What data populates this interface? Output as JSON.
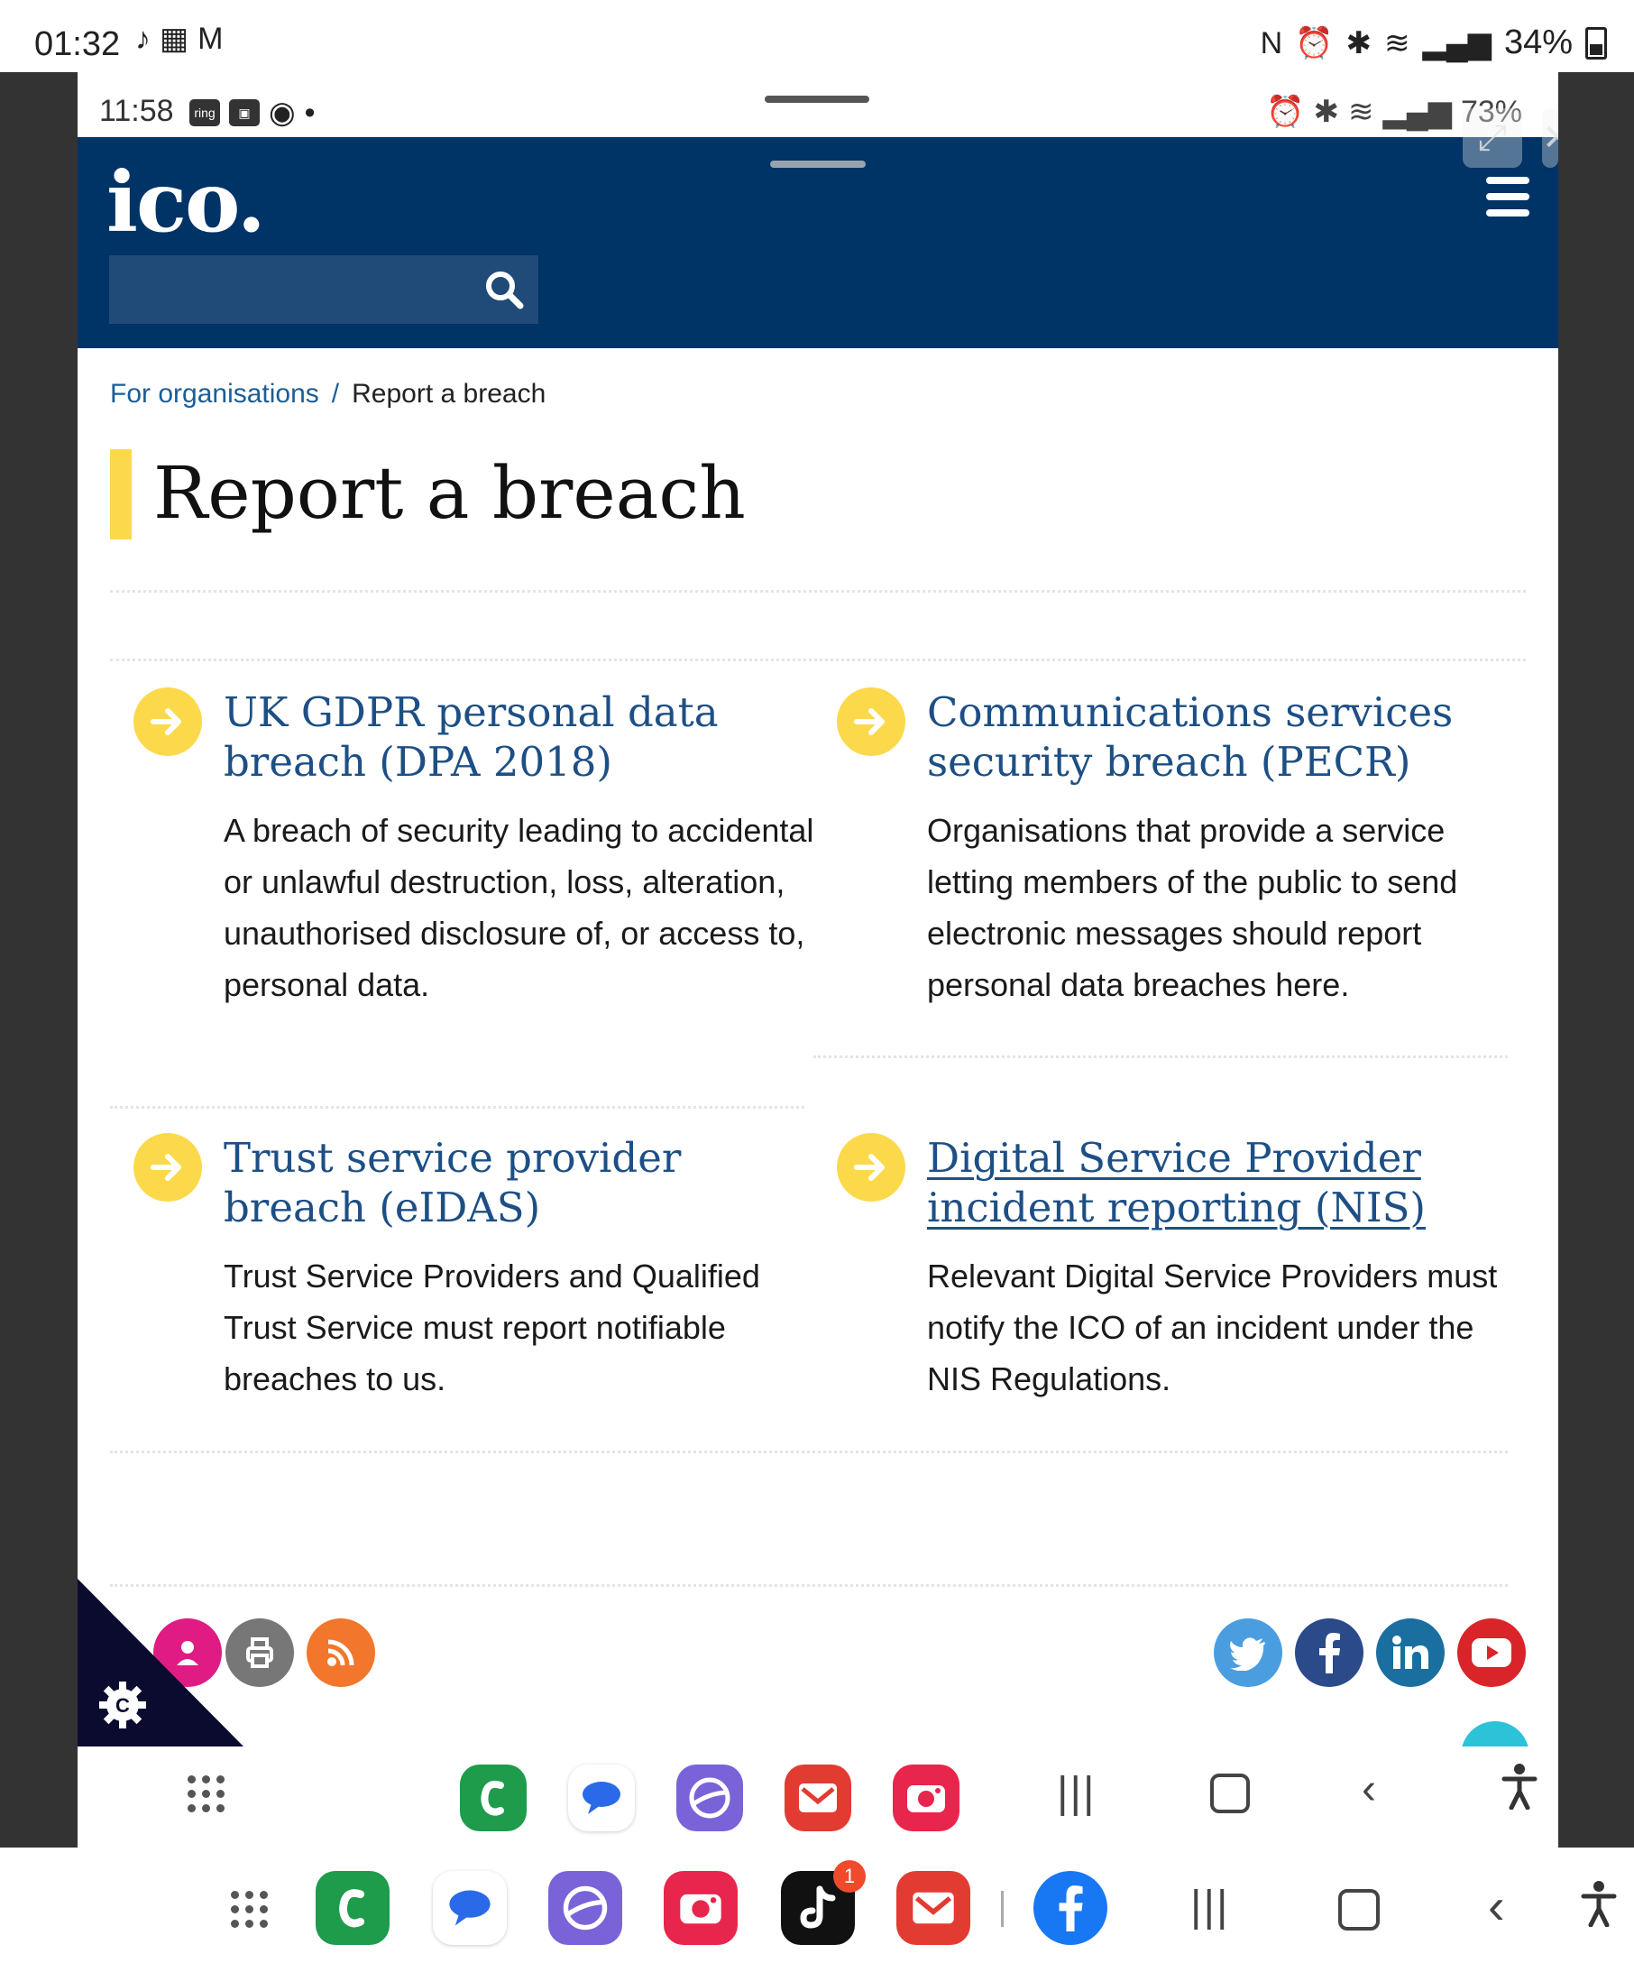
{
  "outer_status": {
    "time": "01:32",
    "battery": "34%"
  },
  "inner_status": {
    "time": "11:58",
    "ring_badge": "ring",
    "battery": "73%"
  },
  "header": {
    "logo": "ico.",
    "search_placeholder": ""
  },
  "breadcrumb": {
    "parent": "For organisations",
    "separator": "/",
    "current": "Report a breach"
  },
  "page_title": "Report a breach",
  "cards": [
    {
      "title": "UK GDPR personal data breach (DPA 2018)",
      "body": "A breach of security leading to accidental or unlawful destruction, loss, alteration, unauthorised disclosure of, or access to, personal data."
    },
    {
      "title": "Communications services security breach (PECR)",
      "body": "Organisations that provide a service letting members of the public to send electronic messages should report personal data breaches here."
    },
    {
      "title": "Trust service provider breach (eIDAS)",
      "body": "Trust Service Providers and Qualified Trust Service must report notifiable breaches to us."
    },
    {
      "title": "Digital Service Provider incident reporting (NIS)",
      "body": "Relevant Digital Service Providers must notify the ICO of an incident under the NIS Regulations."
    }
  ],
  "footer": {
    "share_icons": [
      "share-icon",
      "print-icon",
      "rss-icon"
    ],
    "social": [
      {
        "name": "twitter-icon",
        "color": "#4a9ee0"
      },
      {
        "name": "facebook-icon",
        "color": "#2b4a8a"
      },
      {
        "name": "linkedin-icon",
        "color": "#1a6fa0"
      },
      {
        "name": "youtube-icon",
        "color": "#d9252a"
      }
    ],
    "cookie_letter": "C"
  },
  "dock": {
    "notification_count": "1"
  },
  "colors": {
    "brand_navy": "#003366",
    "accent_yellow": "#fcd94b",
    "link_blue": "#1d4f85"
  }
}
